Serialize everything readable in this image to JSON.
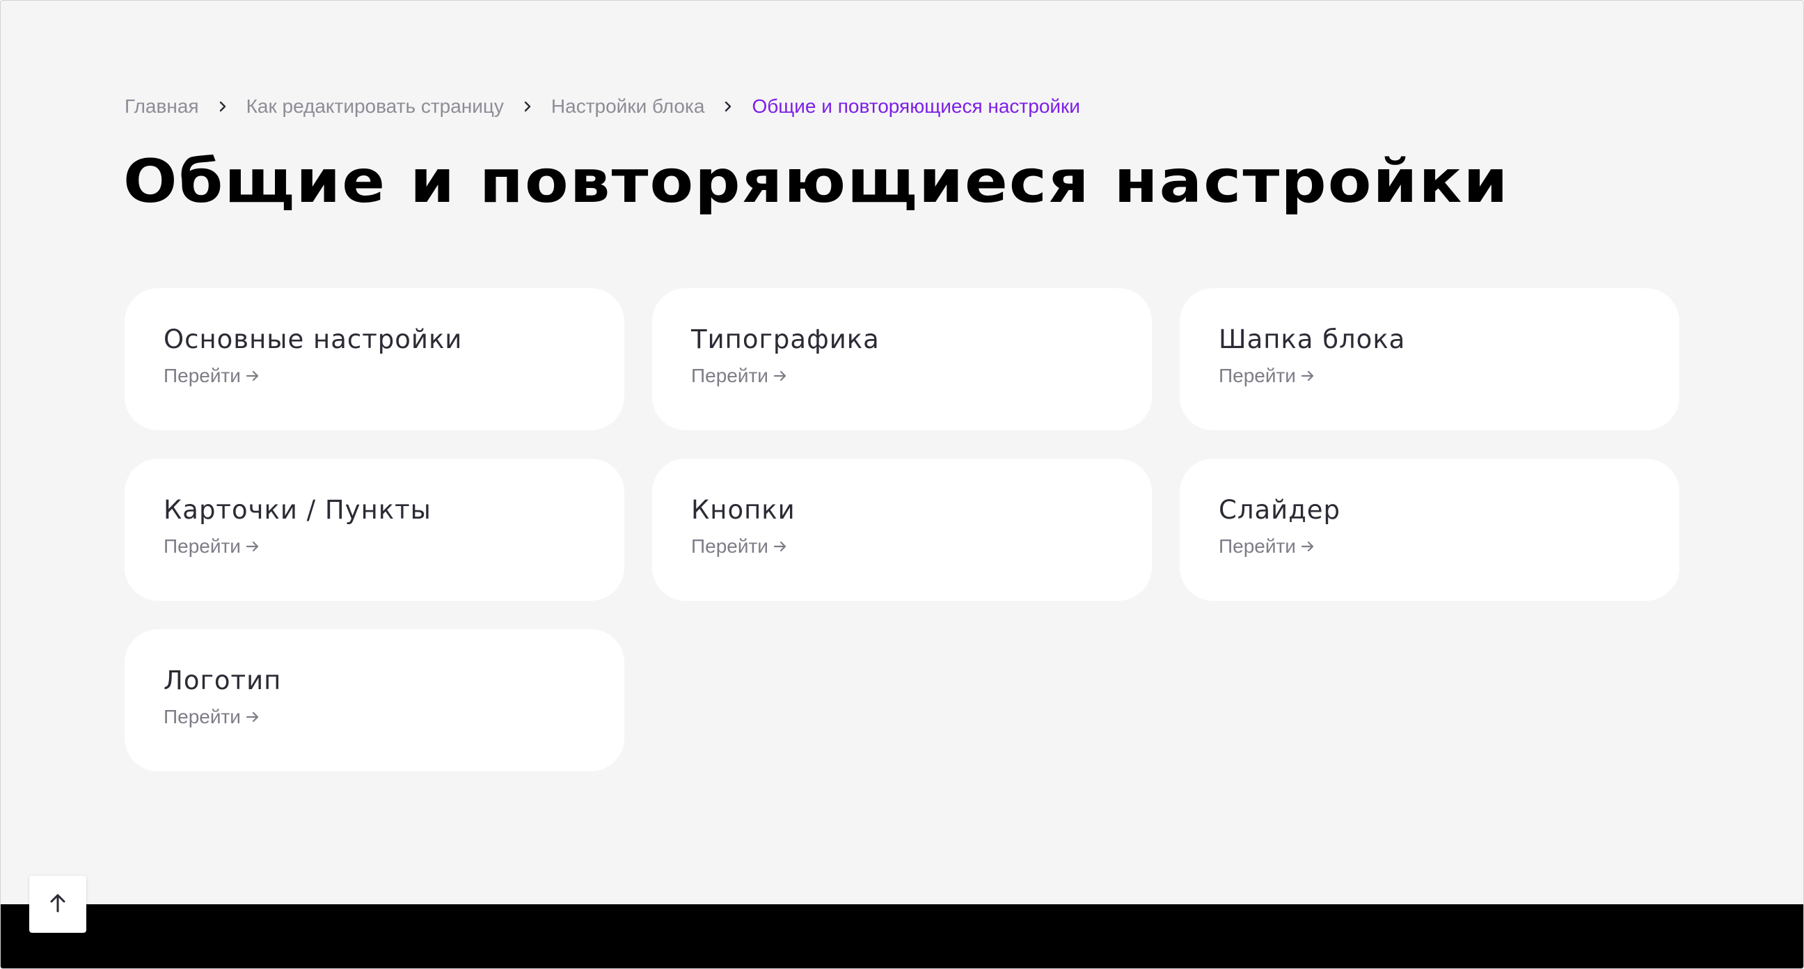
{
  "breadcrumb": {
    "items": [
      {
        "label": "Главная"
      },
      {
        "label": "Как редактировать страницу"
      },
      {
        "label": "Настройки блока"
      }
    ],
    "current": "Общие и повторяющиеся настройки",
    "separator_icon": "chevron-right-icon"
  },
  "page": {
    "title": "Общие и повторяющиеся настройки"
  },
  "cards": [
    {
      "title": "Основные настройки",
      "link": "Перейти"
    },
    {
      "title": "Типографика",
      "link": "Перейти"
    },
    {
      "title": "Шапка блока",
      "link": "Перейти"
    },
    {
      "title": "Карточки / Пункты",
      "link": "Перейти"
    },
    {
      "title": "Кнопки",
      "link": "Перейти"
    },
    {
      "title": "Слайдер",
      "link": "Перейти"
    },
    {
      "title": "Логотип",
      "link": "Перейти"
    }
  ],
  "scroll_top": {
    "icon": "arrow-up-icon"
  },
  "colors": {
    "accent": "#7c1fe6",
    "background": "#f5f5f6",
    "card": "#ffffff",
    "footer": "#000000",
    "muted_text": "#8d8d96",
    "title_text": "#000000"
  }
}
